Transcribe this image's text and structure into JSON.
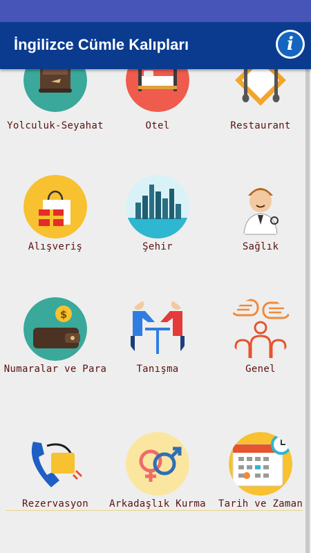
{
  "app": {
    "title": "İngilizce Cümle Kalıpları"
  },
  "header": {
    "info_icon": "info-icon"
  },
  "categories": [
    {
      "label": "Yolculuk-Seyahat",
      "icon": "suitcase-icon",
      "color": "#3aa89a"
    },
    {
      "label": "Otel",
      "icon": "hotel-bed-icon",
      "color": "#ef5b4c"
    },
    {
      "label": "Restaurant",
      "icon": "fork-knife-icon",
      "color": "#f3a52b"
    },
    {
      "label": "Alışveriş",
      "icon": "shopping-bag-icon",
      "color": "#f7c12f"
    },
    {
      "label": "Şehir",
      "icon": "city-skyline-icon",
      "color": "#2fb6d0"
    },
    {
      "label": "Sağlık",
      "icon": "doctor-icon",
      "color": "#ffffff"
    },
    {
      "label": "Numaralar ve Para",
      "icon": "wallet-money-icon",
      "color": "#3aa89a"
    },
    {
      "label": "Tanışma",
      "icon": "meeting-people-icon",
      "color": "#ffffff"
    },
    {
      "label": "Genel",
      "icon": "group-chat-icon",
      "color": "#ffffff"
    },
    {
      "label": "Rezervasyon",
      "icon": "phone-reservation-icon",
      "color": "#ffffff"
    },
    {
      "label": "Arkadaşlık Kurma",
      "icon": "gender-symbols-icon",
      "color": "#fbe6a0"
    },
    {
      "label": "Tarih ve Zaman",
      "icon": "calendar-clock-icon",
      "color": "#f7c12f"
    }
  ]
}
